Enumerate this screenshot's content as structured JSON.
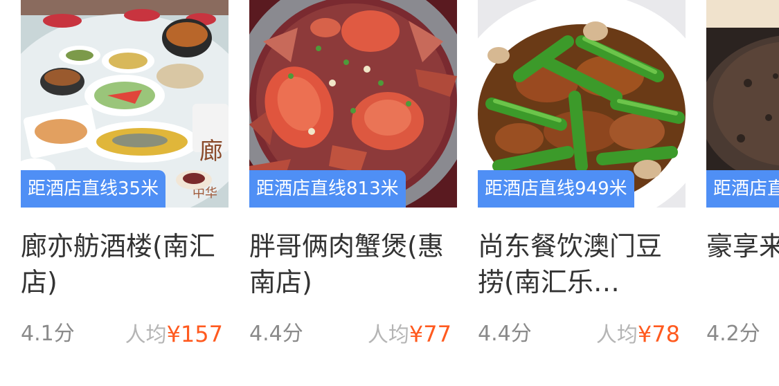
{
  "restaurants": [
    {
      "distance": "距酒店直线35米",
      "name": "廊亦舫酒楼(南汇店)",
      "rating": "4.1分",
      "price_label": "人均",
      "price": "¥157",
      "photo": "banquet-table-photo"
    },
    {
      "distance": "距酒店直线813米",
      "name": "胖哥俩肉蟹煲(惠南店)",
      "rating": "4.4分",
      "price_label": "人均",
      "price": "¥77",
      "photo": "crab-pot-photo"
    },
    {
      "distance": "距酒店直线949米",
      "name": "尚东餐饮澳门豆捞(南汇乐…",
      "rating": "4.4分",
      "price_label": "人均",
      "price": "¥78",
      "photo": "green-pepper-stirfry-photo"
    },
    {
      "distance": "距酒店直",
      "name": "豪享来(南汇店)",
      "rating": "4.2分",
      "price_label": "",
      "price": "",
      "photo": "sizzling-steak-photo"
    }
  ],
  "colors": {
    "tag_bg": "#4f8ff5",
    "price": "#ff5a1f",
    "name": "#333333",
    "rating": "#8a8a8a",
    "price_label": "#b5b5b5"
  }
}
